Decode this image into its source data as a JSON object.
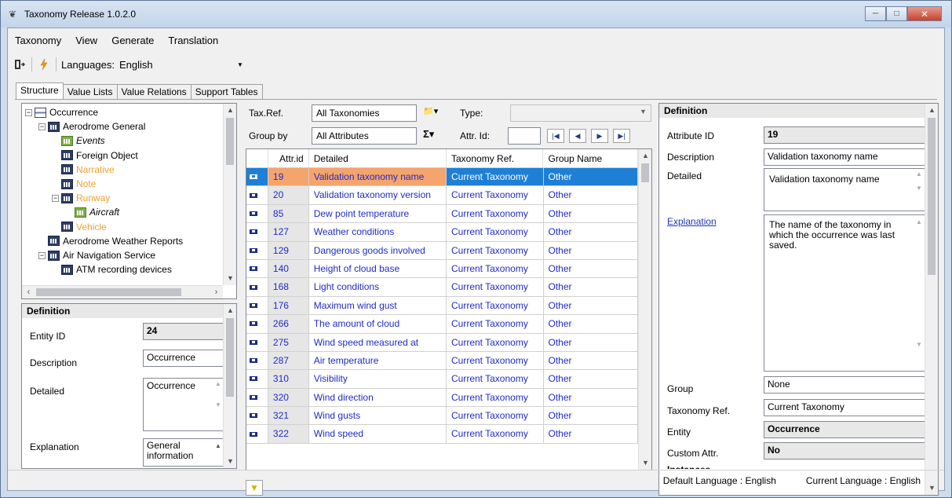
{
  "window": {
    "title": "Taxonomy Release 1.0.2.0",
    "minimize": "─",
    "maximize": "□",
    "close": "✕"
  },
  "menu": [
    "Taxonomy",
    "View",
    "Generate",
    "Translation"
  ],
  "toolbar": {
    "languages_label": "Languages:",
    "language_value": "English",
    "exit_icon": "exit-icon",
    "generate_icon": "lightning-icon"
  },
  "tabs": [
    "Structure",
    "Value Lists",
    "Value Relations",
    "Support Tables"
  ],
  "tree": {
    "nodes": [
      {
        "label": "Occurrence",
        "depth": 0,
        "style": "normal",
        "expander": "−"
      },
      {
        "label": "Aerodrome General",
        "depth": 1,
        "style": "normal",
        "expander": "−"
      },
      {
        "label": "Events",
        "depth": 2,
        "style": "italic",
        "expander": ""
      },
      {
        "label": "Foreign Object",
        "depth": 2,
        "style": "normal",
        "expander": ""
      },
      {
        "label": "Narrative",
        "depth": 2,
        "style": "orange",
        "expander": ""
      },
      {
        "label": "Note",
        "depth": 2,
        "style": "orange",
        "expander": ""
      },
      {
        "label": "Runway",
        "depth": 2,
        "style": "orange",
        "expander": "−"
      },
      {
        "label": "Aircraft",
        "depth": 3,
        "style": "italic",
        "expander": ""
      },
      {
        "label": "Vehicle",
        "depth": 2,
        "style": "orange",
        "expander": ""
      },
      {
        "label": "Aerodrome Weather Reports",
        "depth": 1,
        "style": "normal",
        "expander": ""
      },
      {
        "label": "Air Navigation Service",
        "depth": 1,
        "style": "normal",
        "expander": "−"
      },
      {
        "label": "ATM recording devices",
        "depth": 2,
        "style": "normal",
        "expander": ""
      }
    ]
  },
  "left_def": {
    "header": "Definition",
    "entity_id_label": "Entity ID",
    "entity_id_value": "24",
    "description_label": "Description",
    "description_value": "Occurrence",
    "detailed_label": "Detailed",
    "detailed_value": "Occurrence",
    "explanation_label": "Explanation",
    "explanation_value": "General information"
  },
  "middle": {
    "taxref_label": "Tax.Ref.",
    "taxref_value": "All Taxonomies",
    "type_label": "Type:",
    "type_value": "",
    "groupby_label": "Group by",
    "groupby_value": "All Attributes",
    "attrid_label": "Attr. Id:",
    "attrid_value": ""
  },
  "grid": {
    "columns": [
      "",
      "Attr.id",
      "Detailed",
      "Taxonomy Ref.",
      "Group Name"
    ],
    "rows": [
      {
        "id": "19",
        "detailed": "Validation taxonomy name",
        "taxref": "Current Taxonomy",
        "group": "Other",
        "selected": true
      },
      {
        "id": "20",
        "detailed": "Validation taxonomy version",
        "taxref": "Current Taxonomy",
        "group": "Other"
      },
      {
        "id": "85",
        "detailed": "Dew point temperature",
        "taxref": "Current Taxonomy",
        "group": "Other"
      },
      {
        "id": "127",
        "detailed": "Weather conditions",
        "taxref": "Current Taxonomy",
        "group": "Other"
      },
      {
        "id": "129",
        "detailed": "Dangerous goods involved",
        "taxref": "Current Taxonomy",
        "group": "Other"
      },
      {
        "id": "140",
        "detailed": "Height of cloud base",
        "taxref": "Current Taxonomy",
        "group": "Other"
      },
      {
        "id": "168",
        "detailed": "Light conditions",
        "taxref": "Current Taxonomy",
        "group": "Other"
      },
      {
        "id": "176",
        "detailed": "Maximum wind gust",
        "taxref": "Current Taxonomy",
        "group": "Other"
      },
      {
        "id": "266",
        "detailed": "The amount of cloud",
        "taxref": "Current Taxonomy",
        "group": "Other"
      },
      {
        "id": "275",
        "detailed": "Wind speed measured at",
        "taxref": "Current Taxonomy",
        "group": "Other"
      },
      {
        "id": "287",
        "detailed": "Air temperature",
        "taxref": "Current Taxonomy",
        "group": "Other"
      },
      {
        "id": "310",
        "detailed": "Visibility",
        "taxref": "Current Taxonomy",
        "group": "Other"
      },
      {
        "id": "320",
        "detailed": "Wind direction",
        "taxref": "Current Taxonomy",
        "group": "Other"
      },
      {
        "id": "321",
        "detailed": "Wind gusts",
        "taxref": "Current Taxonomy",
        "group": "Other"
      },
      {
        "id": "322",
        "detailed": "Wind speed",
        "taxref": "Current Taxonomy",
        "group": "Other"
      }
    ]
  },
  "right_def": {
    "header": "Definition",
    "attribute_id_label": "Attribute ID",
    "attribute_id_value": "19",
    "description_label": "Description",
    "description_value": "Validation taxonomy name",
    "detailed_label": "Detailed",
    "detailed_value": "Validation taxonomy name",
    "explanation_label": "Explanation",
    "explanation_value": "The name of the taxonomy in which the occurrence was last saved.",
    "group_label": "Group",
    "group_value": "None",
    "taxref_label": "Taxonomy Ref.",
    "taxref_value": "Current Taxonomy",
    "entity_label": "Entity",
    "entity_value": "Occurrence",
    "custom_label": "Custom Attr.",
    "custom_value": "No",
    "instances_label": "Instances"
  },
  "status": {
    "default_language": "Default Language : English",
    "current_language": "Current Language : English"
  }
}
